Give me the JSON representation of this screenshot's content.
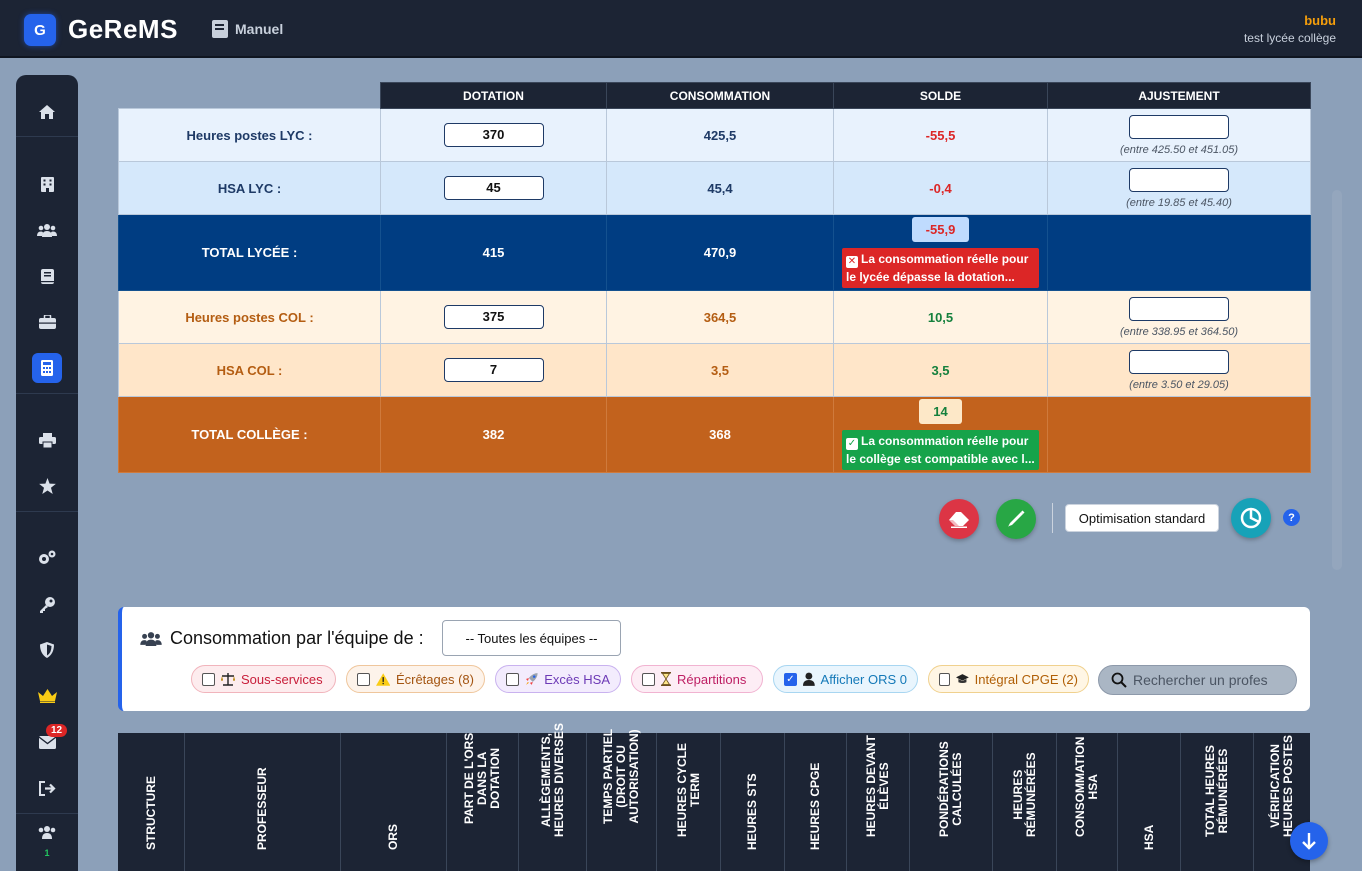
{
  "header": {
    "logo_letter": "G",
    "app_name": "GeReMS",
    "manual_label": "Manuel",
    "user_name": "bubu",
    "user_sub": "test lycée collège"
  },
  "sidebar": {
    "mail_badge": "12",
    "users_count": "1"
  },
  "dotation_table": {
    "headers": [
      "DOTATION",
      "CONSOMMATION",
      "SOLDE",
      "AJUSTEMENT"
    ],
    "rows": [
      {
        "label": "Heures postes LYC :",
        "dotation": "370",
        "consommation": "425,5",
        "solde": "-55,5",
        "hint": "(entre 425.50 et 451.05)"
      },
      {
        "label": "HSA LYC :",
        "dotation": "45",
        "consommation": "45,4",
        "solde": "-0,4",
        "hint": "(entre 19.85 et 45.40)"
      },
      {
        "label": "TOTAL LYCÉE :",
        "dotation": "415",
        "consommation": "470,9",
        "solde": "-55,9",
        "alert": "La consommation réelle pour le lycée dépasse la dotation..."
      },
      {
        "label": "Heures postes COL :",
        "dotation": "375",
        "consommation": "364,5",
        "solde": "10,5",
        "hint": "(entre 338.95 et 364.50)"
      },
      {
        "label": "HSA COL :",
        "dotation": "7",
        "consommation": "3,5",
        "solde": "3,5",
        "hint": "(entre 3.50 et 29.05)"
      },
      {
        "label": "TOTAL COLLÈGE :",
        "dotation": "382",
        "consommation": "368",
        "solde": "14",
        "alert": "La consommation réelle pour le collège est compatible avec l..."
      }
    ]
  },
  "actions": {
    "optimisation_label": "Optimisation standard",
    "help": "?"
  },
  "filter": {
    "title": "Consommation par l'équipe de :",
    "select_value": "-- Toutes les équipes --",
    "pills": [
      {
        "label": "Sous-services",
        "checked": false
      },
      {
        "label": "Écrêtages (8)",
        "checked": false
      },
      {
        "label": "Excès HSA",
        "checked": false
      },
      {
        "label": "Répartitions",
        "checked": false
      },
      {
        "label": "Afficher ORS 0",
        "checked": true
      },
      {
        "label": "Intégral CPGE (2)",
        "checked": false
      }
    ],
    "search_placeholder": "Rechercher un profes"
  },
  "main_table": {
    "columns": [
      "STRUCTURE",
      "PROFESSEUR",
      "ORS",
      "PART DE L'ORS\nDANS LA\nDOTATION",
      "ALLÈGEMENTS,\nHEURES DIVERSES",
      "TEMPS PARTIEL\n(DROIT OU\nAUTORISATION)",
      "HEURES CYCLE\nTERM",
      "HEURES STS",
      "HEURES CPGE",
      "HEURES DEVANT\nÉLÈVES",
      "PONDÉRATIONS\nCALCULÉES",
      "HEURES\nRÉMUNÉRÉES",
      "CONSOMMATION\nHSA",
      "HSA",
      "TOTAL HEURES\nRÉMUNÉRÉES",
      "VÉRIFICATION\nHEURES POSTES"
    ]
  },
  "colors": {
    "navy": "#1c2434",
    "blue_total": "#003d82",
    "orange_total": "#c2621d",
    "accent": "#2563eb"
  }
}
